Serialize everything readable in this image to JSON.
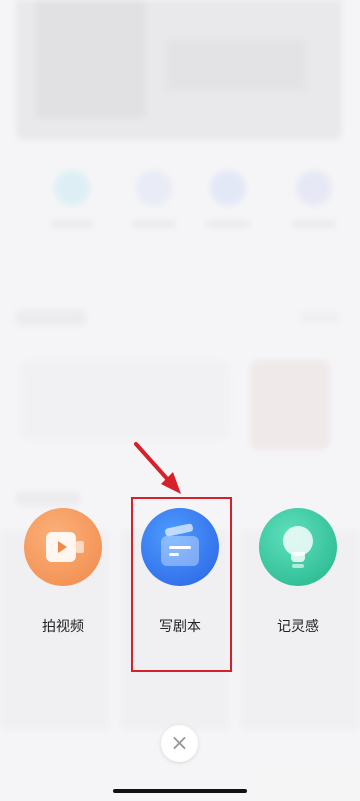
{
  "actions": [
    {
      "label": "拍视频",
      "icon": "video-icon",
      "color": "#f08a4a"
    },
    {
      "label": "写剧本",
      "icon": "script-icon",
      "color": "#2a62e4"
    },
    {
      "label": "记灵感",
      "icon": "lightbulb-icon",
      "color": "#22b48a"
    }
  ],
  "close": {
    "glyph": "×"
  },
  "highlight_color": "#d8202a"
}
